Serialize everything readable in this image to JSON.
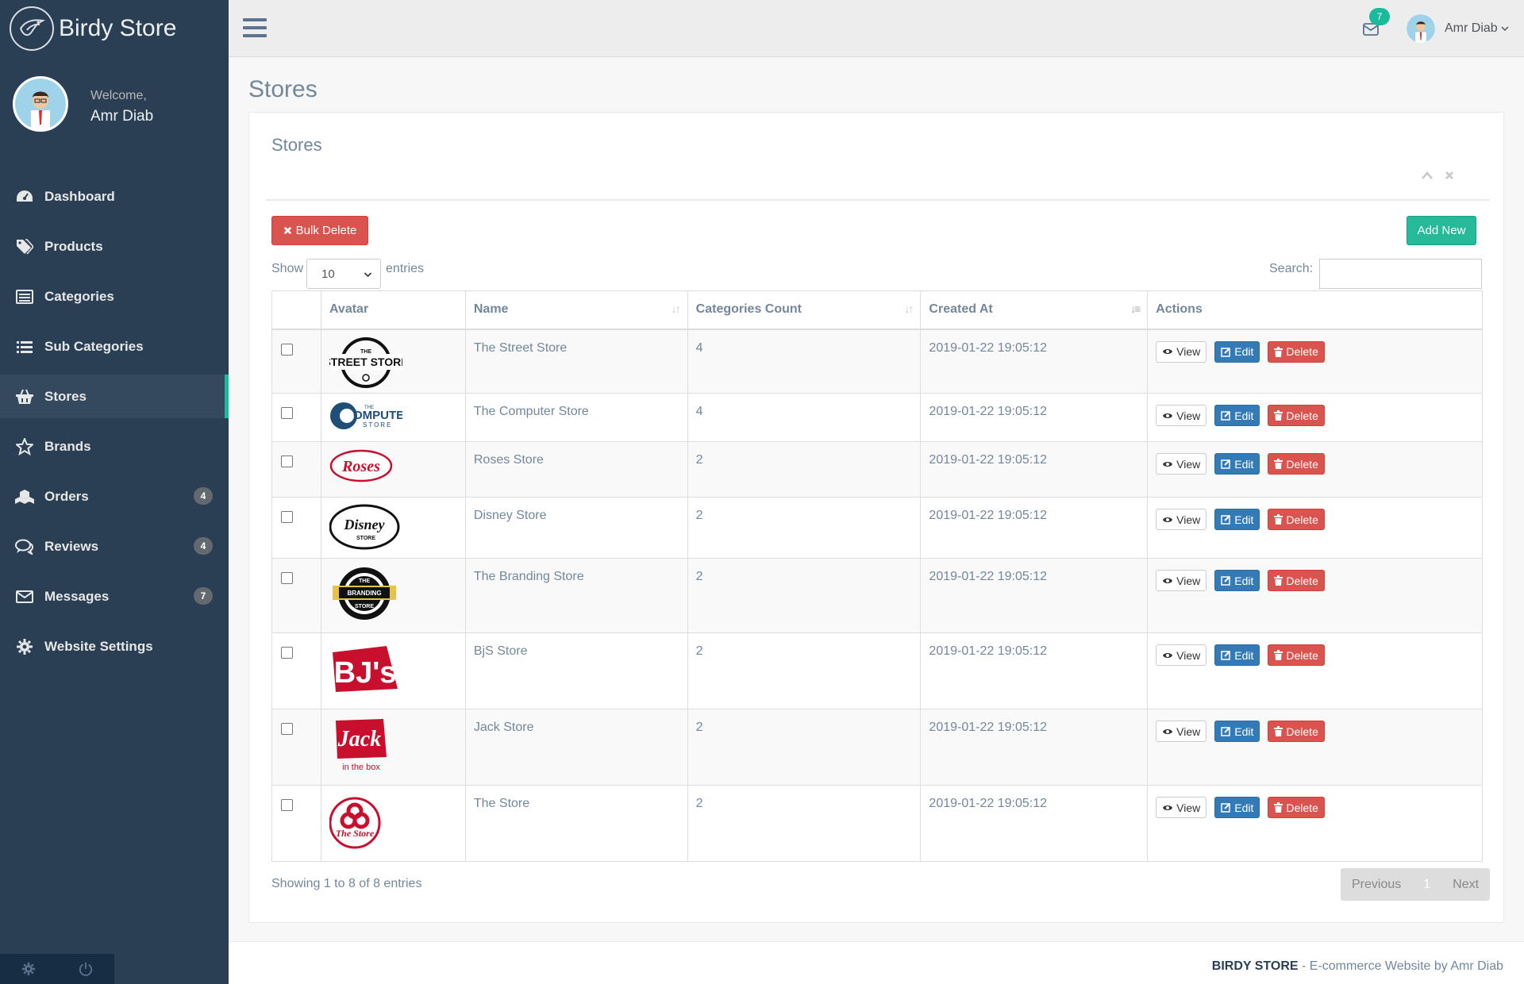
{
  "app": {
    "brand": "Birdy Store",
    "welcome": "Welcome,",
    "user_name": "Amr Diab",
    "mail_count": "7"
  },
  "sidebar": {
    "items": [
      {
        "label": "Dashboard",
        "icon": "dashboard-icon"
      },
      {
        "label": "Products",
        "icon": "tags-icon"
      },
      {
        "label": "Categories",
        "icon": "list-alt-icon"
      },
      {
        "label": "Sub Categories",
        "icon": "list-icon"
      },
      {
        "label": "Stores",
        "icon": "basket-icon",
        "active": true
      },
      {
        "label": "Brands",
        "icon": "star-icon"
      },
      {
        "label": "Orders",
        "icon": "cubes-icon",
        "badge": "4"
      },
      {
        "label": "Reviews",
        "icon": "comments-icon",
        "badge": "4"
      },
      {
        "label": "Messages",
        "icon": "envelope-icon",
        "badge": "7"
      },
      {
        "label": "Website Settings",
        "icon": "cog-icon"
      }
    ]
  },
  "page": {
    "title": "Stores",
    "panel_title": "Stores",
    "bulk_delete_label": "Bulk Delete",
    "add_new_label": "Add New",
    "show_label": "Show",
    "entries_label": "entries",
    "page_length": "10",
    "search_label": "Search:",
    "search_value": ""
  },
  "table": {
    "columns": [
      "",
      "Avatar",
      "Name",
      "Categories Count",
      "Created At",
      "Actions"
    ],
    "action_labels": {
      "view": "View",
      "edit": "Edit",
      "delete": "Delete"
    },
    "rows": [
      {
        "name": "The Street Store",
        "count": "4",
        "created": "2019-01-22 19:05:12",
        "logo": "street-store-logo",
        "logo_text": [
          "THE",
          "STREET STORE"
        ]
      },
      {
        "name": "The Computer Store",
        "count": "4",
        "created": "2019-01-22 19:05:12",
        "logo": "computer-store-logo",
        "logo_text": [
          "THE",
          "OMPUTER",
          "STORE"
        ]
      },
      {
        "name": "Roses Store",
        "count": "2",
        "created": "2019-01-22 19:05:12",
        "logo": "roses-logo",
        "logo_text": [
          "Roses"
        ]
      },
      {
        "name": "Disney Store",
        "count": "2",
        "created": "2019-01-22 19:05:12",
        "logo": "disney-store-logo",
        "logo_text": [
          "Disney",
          "STORE"
        ]
      },
      {
        "name": "The Branding Store",
        "count": "2",
        "created": "2019-01-22 19:05:12",
        "logo": "branding-store-logo",
        "logo_text": [
          "THE",
          "BRANDING",
          "STORE"
        ]
      },
      {
        "name": "BjS Store",
        "count": "2",
        "created": "2019-01-22 19:05:12",
        "logo": "bjs-logo",
        "logo_text": [
          "BJ's"
        ]
      },
      {
        "name": "Jack Store",
        "count": "2",
        "created": "2019-01-22 19:05:12",
        "logo": "jack-in-the-box-logo",
        "logo_text": [
          "Jack",
          "in the box"
        ]
      },
      {
        "name": "The Store",
        "count": "2",
        "created": "2019-01-22 19:05:12",
        "logo": "the-store-logo",
        "logo_text": [
          "The Store"
        ]
      }
    ]
  },
  "pagination": {
    "info": "Showing 1 to 8 of 8 entries",
    "previous": "Previous",
    "current": "1",
    "next": "Next"
  },
  "footer": {
    "brand": "BIRDY STORE",
    "text": " - E-commerce Website by Amr Diab"
  },
  "colors": {
    "sidebar_bg": "#2a3f54",
    "accent_green": "#1abb9c",
    "danger": "#d9534f",
    "primary": "#337ab7"
  }
}
